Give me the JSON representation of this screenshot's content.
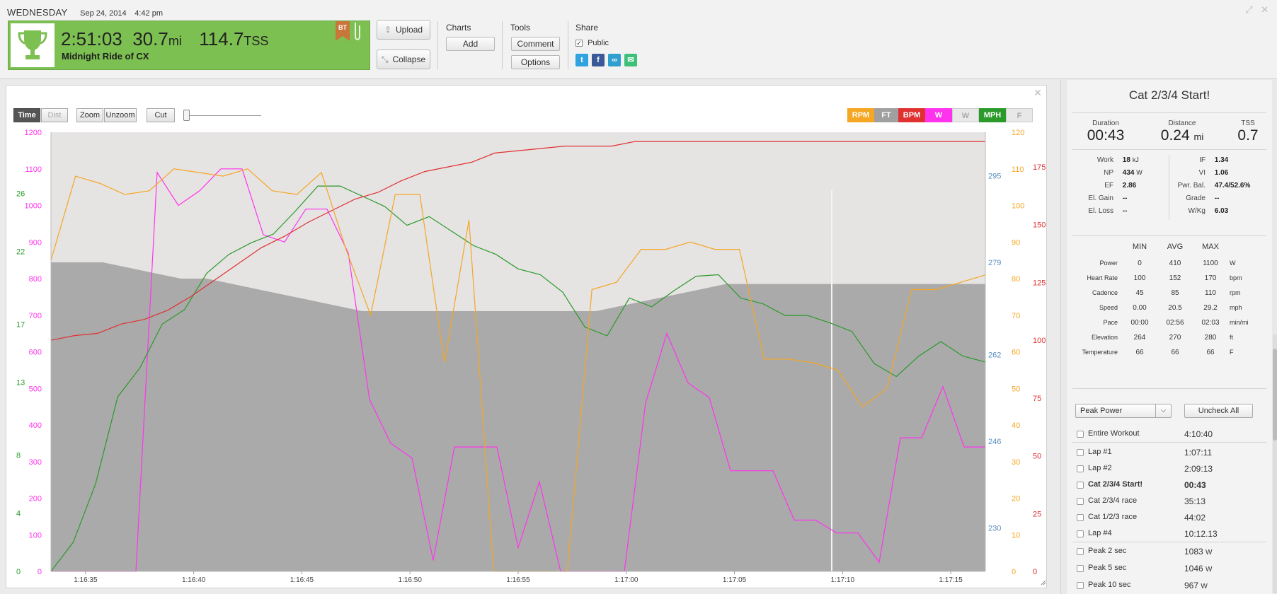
{
  "header": {
    "day_of_week": "WEDNESDAY",
    "date": "Sep 24, 2014",
    "time": "4:42 pm",
    "duration": "2:51:03",
    "distance": "30.7",
    "distance_unit": "mi",
    "tss": "114.7",
    "tss_unit": "TSS",
    "workout_title": "Midnight Ride of CX",
    "badge": "BT",
    "upload_label": "Upload",
    "collapse_label": "Collapse",
    "charts_heading": "Charts",
    "add_label": "Add",
    "tools_heading": "Tools",
    "comment_label": "Comment",
    "options_label": "Options",
    "share_heading": "Share",
    "public_label": "Public",
    "accent": "#7dc052"
  },
  "chart_controls": {
    "time": "Time",
    "dist": "Dist",
    "zoom": "Zoom",
    "unzoom": "Unzoom",
    "cut": "Cut",
    "legend": [
      {
        "label": "RPM",
        "color": "#f5a623"
      },
      {
        "label": "FT",
        "color": "#a0a0a0"
      },
      {
        "label": "BPM",
        "color": "#e03030"
      },
      {
        "label": "W",
        "color": "#ff33ee"
      },
      {
        "label": "W",
        "color": "#e8e8e8"
      },
      {
        "label": "MPH",
        "color": "#2a9a2a"
      },
      {
        "label": "F",
        "color": "#e8e8e8"
      }
    ]
  },
  "chart_data": {
    "type": "line",
    "x": [
      "1:16:33",
      "1:16:34",
      "1:16:35",
      "1:16:36",
      "1:16:37",
      "1:16:38",
      "1:16:39",
      "1:16:40",
      "1:16:41",
      "1:16:42",
      "1:16:43",
      "1:16:44",
      "1:16:45",
      "1:16:46",
      "1:16:47",
      "1:16:48",
      "1:16:49",
      "1:16:50",
      "1:16:51",
      "1:16:52",
      "1:16:53",
      "1:16:54",
      "1:16:55",
      "1:16:56",
      "1:16:57",
      "1:16:58",
      "1:16:59",
      "1:17:00",
      "1:17:01",
      "1:17:02",
      "1:17:03",
      "1:17:04",
      "1:17:05",
      "1:17:06",
      "1:17:07",
      "1:17:08",
      "1:17:09",
      "1:17:10",
      "1:17:11",
      "1:17:12",
      "1:17:13",
      "1:17:14",
      "1:17:15",
      "1:17:16",
      "1:17:17"
    ],
    "x_ticks": [
      "1:16:35",
      "1:16:40",
      "1:16:45",
      "1:16:50",
      "1:16:55",
      "1:17:00",
      "1:17:05",
      "1:17:10",
      "1:17:15"
    ],
    "series": [
      {
        "name": "W",
        "color": "#ff33ee",
        "axis": "w",
        "values": [
          0,
          0,
          0,
          0,
          0,
          1090,
          1000,
          1040,
          1100,
          1100,
          920,
          900,
          990,
          990,
          870,
          470,
          350,
          310,
          30,
          340,
          340,
          340,
          65,
          245,
          0,
          0,
          0,
          0,
          460,
          650,
          515,
          475,
          275,
          275,
          275,
          140,
          140,
          105,
          105,
          25,
          365,
          365,
          505,
          340,
          340
        ]
      },
      {
        "name": "MPH",
        "color": "#2a9a2a",
        "axis": "mph",
        "values": [
          0,
          2,
          6,
          12,
          14,
          17,
          18,
          20.5,
          21.8,
          22.6,
          23.2,
          24.8,
          26.5,
          26.5,
          25.8,
          25.1,
          23.8,
          24.4,
          23.4,
          22.4,
          21.8,
          20.8,
          20.4,
          19.2,
          16.8,
          16.2,
          18.8,
          18.2,
          19.3,
          20.3,
          20.4,
          18.8,
          18.4,
          17.6,
          17.6,
          17.1,
          16.5,
          14.3,
          13.4,
          14.8,
          15.8,
          14.8,
          14.4
        ]
      },
      {
        "name": "BPM",
        "color": "#e03030",
        "axis": "bpm",
        "values": [
          100,
          102,
          103,
          107,
          109,
          113,
          119,
          126,
          133,
          140,
          145,
          151,
          156,
          161,
          164,
          169,
          173,
          175,
          177,
          181,
          182,
          183,
          184,
          184,
          184,
          186,
          186,
          186,
          186,
          186,
          186,
          186,
          186,
          186,
          186,
          186,
          186,
          186,
          186,
          186,
          186
        ]
      },
      {
        "name": "RPM",
        "color": "#f5a623",
        "axis": "rpm",
        "values": [
          85,
          108,
          106,
          103,
          104,
          110,
          109,
          108,
          110,
          104,
          103,
          109,
          88,
          70,
          103,
          103,
          57,
          96,
          0,
          0,
          0,
          0,
          77,
          79,
          88,
          88,
          90,
          88,
          88,
          58,
          58,
          57,
          55,
          45,
          50,
          77,
          77,
          79,
          81
        ]
      },
      {
        "name": "FT",
        "color": "#a0a0a0",
        "axis": "ft",
        "values": [
          279,
          279,
          279,
          278,
          277,
          276,
          276,
          275,
          274,
          273,
          272,
          271,
          270,
          270,
          270,
          270,
          270,
          270,
          270,
          270,
          270,
          270,
          271,
          272,
          273,
          274,
          275,
          275,
          275,
          275,
          275,
          275,
          275,
          275,
          275,
          275,
          275
        ]
      }
    ],
    "axes": {
      "w": {
        "ticks": [
          0,
          100,
          200,
          300,
          400,
          500,
          600,
          700,
          800,
          900,
          1000,
          1100,
          1200
        ],
        "color": "#ff33ee"
      },
      "mph": {
        "ticks": [
          0,
          4,
          8,
          13,
          17,
          22,
          26
        ],
        "color": "#2a9a2a"
      },
      "rpm": {
        "ticks": [
          0,
          10,
          20,
          30,
          40,
          50,
          60,
          70,
          80,
          90,
          100,
          110,
          120
        ],
        "color": "#f5a623"
      },
      "bpm": {
        "ticks": [
          0,
          25,
          50,
          75,
          100,
          125,
          150,
          175
        ],
        "color": "#e03030"
      },
      "ft": {
        "ticks": [
          230,
          246,
          262,
          279,
          295
        ],
        "color": "#5b8ec0"
      }
    }
  },
  "side": {
    "title": "Cat 2/3/4 Start!",
    "highlights": [
      {
        "label": "Duration",
        "value": "00:43",
        "unit": ""
      },
      {
        "label": "Distance",
        "value": "0.24",
        "unit": "mi"
      },
      {
        "label": "TSS",
        "value": "0.7",
        "unit": ""
      }
    ],
    "left_stats": [
      {
        "k": "Work",
        "v": "18",
        "u": "kJ"
      },
      {
        "k": "NP",
        "v": "434",
        "u": "W"
      },
      {
        "k": "EF",
        "v": "2.86",
        "u": ""
      },
      {
        "k": "El. Gain",
        "v": "--",
        "u": ""
      },
      {
        "k": "El. Loss",
        "v": "--",
        "u": ""
      }
    ],
    "right_stats": [
      {
        "k": "IF",
        "v": "1.34"
      },
      {
        "k": "VI",
        "v": "1.06"
      },
      {
        "k": "Pwr. Bal.",
        "v": "47.4/52.6%"
      },
      {
        "k": "Grade",
        "v": "--"
      },
      {
        "k": "W/Kg",
        "v": "6.03"
      }
    ],
    "mm_headers": [
      "MIN",
      "AVG",
      "MAX"
    ],
    "mm_rows": [
      {
        "name": "Power",
        "min": "0",
        "avg": "410",
        "max": "1100",
        "unit": "W"
      },
      {
        "name": "Heart Rate",
        "min": "100",
        "avg": "152",
        "max": "170",
        "unit": "bpm"
      },
      {
        "name": "Cadence",
        "min": "45",
        "avg": "85",
        "max": "110",
        "unit": "rpm"
      },
      {
        "name": "Speed",
        "min": "0.00",
        "avg": "20.5",
        "max": "29.2",
        "unit": "mph"
      },
      {
        "name": "Pace",
        "min": "00:00",
        "avg": "02:56",
        "max": "02:03",
        "unit": "min/mi"
      },
      {
        "name": "Elevation",
        "min": "264",
        "avg": "270",
        "max": "280",
        "unit": "ft"
      },
      {
        "name": "Temperature",
        "min": "66",
        "avg": "66",
        "max": "66",
        "unit": "F"
      }
    ],
    "dropdown_value": "Peak Power",
    "uncheck_label": "Uncheck All",
    "laps": [
      {
        "name": "Entire Workout",
        "value": "4:10:40",
        "unit": "",
        "bold": false
      },
      {
        "name": "Lap #1",
        "value": "1:07:11",
        "unit": "",
        "bold": false
      },
      {
        "name": "Lap #2",
        "value": "2:09:13",
        "unit": "",
        "bold": false
      },
      {
        "name": "Cat 2/3/4 Start!",
        "value": "00:43",
        "unit": "",
        "bold": true
      },
      {
        "name": "Cat 2/3/4 race",
        "value": "35:13",
        "unit": "",
        "bold": false
      },
      {
        "name": "Cat 1/2/3 race",
        "value": "44:02",
        "unit": "",
        "bold": false
      },
      {
        "name": "Lap #4",
        "value": "10:12.13",
        "unit": "",
        "bold": false
      },
      {
        "name": "Peak 2 sec",
        "value": "1083",
        "unit": "W",
        "bold": false
      },
      {
        "name": "Peak 5 sec",
        "value": "1046",
        "unit": "W",
        "bold": false
      },
      {
        "name": "Peak 10 sec",
        "value": "967",
        "unit": "W",
        "bold": false
      }
    ]
  }
}
